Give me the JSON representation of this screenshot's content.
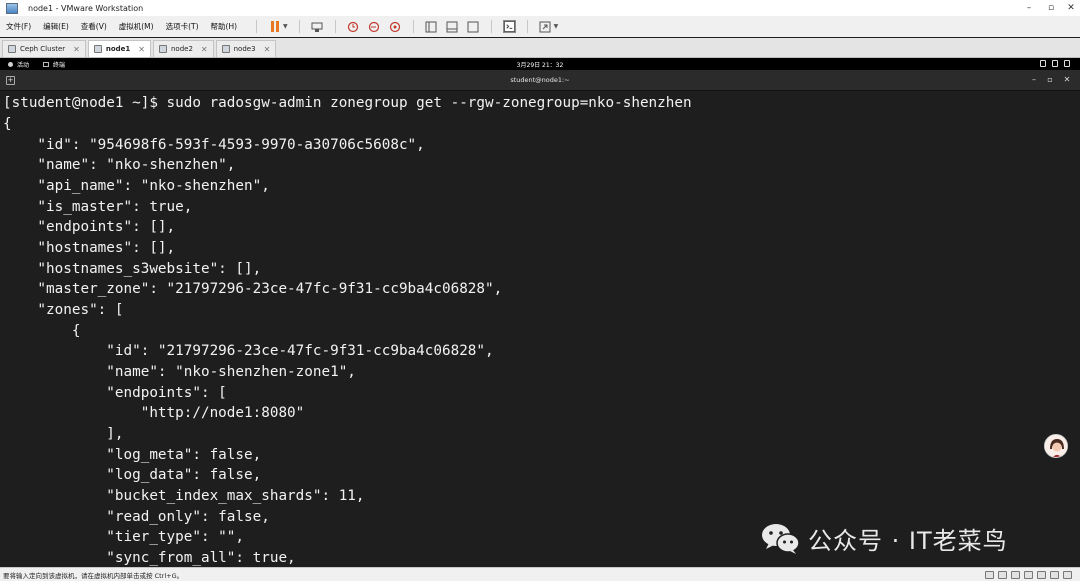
{
  "window": {
    "title": "node1 - VMware Workstation",
    "controls": [
      "minimize",
      "maximize",
      "close"
    ]
  },
  "menu": {
    "items": [
      "文件(F)",
      "编辑(E)",
      "查看(V)",
      "虚拟机(M)",
      "选项卡(T)",
      "帮助(H)"
    ]
  },
  "toolbar": {
    "icons": [
      "pause-icon",
      "send-keys-icon",
      "snapshot-take-icon",
      "snapshot-revert-icon",
      "snapshot-manager-icon",
      "library-view-icon",
      "thumbnail-view-icon",
      "console-view-icon",
      "terminal-icon",
      "fullscreen-icon"
    ],
    "accent": "#e87722"
  },
  "tabs": [
    {
      "label": "Ceph Cluster",
      "active": false
    },
    {
      "label": "node1",
      "active": true
    },
    {
      "label": "node2",
      "active": false
    },
    {
      "label": "node3",
      "active": false
    }
  ],
  "gnome": {
    "activities": "活动",
    "app": "终端",
    "clock": "3月29日  21：32"
  },
  "terminal": {
    "title": "student@node1:~",
    "lines": [
      "[student@node1 ~]$ sudo radosgw-admin zonegroup get --rgw-zonegroup=nko-shenzhen",
      "{",
      "    \"id\": \"954698f6-593f-4593-9970-a30706c5608c\",",
      "    \"name\": \"nko-shenzhen\",",
      "    \"api_name\": \"nko-shenzhen\",",
      "    \"is_master\": true,",
      "    \"endpoints\": [],",
      "    \"hostnames\": [],",
      "    \"hostnames_s3website\": [],",
      "    \"master_zone\": \"21797296-23ce-47fc-9f31-cc9ba4c06828\",",
      "    \"zones\": [",
      "        {",
      "            \"id\": \"21797296-23ce-47fc-9f31-cc9ba4c06828\",",
      "            \"name\": \"nko-shenzhen-zone1\",",
      "            \"endpoints\": [",
      "                \"http://node1:8080\"",
      "            ],",
      "            \"log_meta\": false,",
      "            \"log_data\": false,",
      "            \"bucket_index_max_shards\": 11,",
      "            \"read_only\": false,",
      "            \"tier_type\": \"\",",
      "            \"sync_from_all\": true,"
    ]
  },
  "watermark": {
    "text": "公众号 · IT老菜鸟"
  },
  "status": {
    "text": "要将输入定向到该虚拟机，请在虚拟机内部单击或按 Ctrl+G。"
  },
  "colors": {
    "terminal_bg": "#1e1e1e",
    "terminal_fg": "#f2f2f2",
    "chrome_bg": "#f0f0f0"
  }
}
